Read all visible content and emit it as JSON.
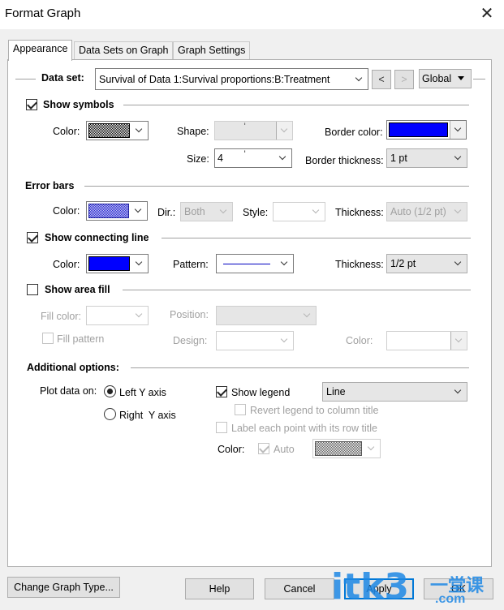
{
  "window": {
    "title": "Format Graph",
    "close_glyph": "✕"
  },
  "tabs": [
    {
      "label": "Appearance"
    },
    {
      "label": "Data Sets on Graph"
    },
    {
      "label": "Graph Settings"
    }
  ],
  "dataset": {
    "label": "Data set:",
    "value": "Survival of Data 1:Survival proportions:B:Treatment",
    "prev_label": "<",
    "next_label": ">",
    "scope_value": "Global"
  },
  "symbols": {
    "title": "Show symbols",
    "checked": true,
    "color_label": "Color:",
    "shape_label": "Shape:",
    "shape_value": "ˈ",
    "border_color_label": "Border color:",
    "size_label": "Size:",
    "size_value": "4",
    "size_marker": "ˈ",
    "border_thickness_label": "Border thickness:",
    "border_thickness_value": "1 pt",
    "border_color": "#0000ff"
  },
  "error_bars": {
    "title": "Error bars",
    "color_label": "Color:",
    "dir_label": "Dir.:",
    "dir_value": "Both",
    "style_label": "Style:",
    "style_value": "",
    "thickness_label": "Thickness:",
    "thickness_value": "Auto (1/2 pt)"
  },
  "connecting_line": {
    "title": "Show connecting line",
    "checked": true,
    "color_label": "Color:",
    "color": "#0000ff",
    "pattern_label": "Pattern:",
    "thickness_label": "Thickness:",
    "thickness_value": "1/2 pt"
  },
  "area_fill": {
    "title": "Show area fill",
    "checked": false,
    "fill_color_label": "Fill color:",
    "position_label": "Position:",
    "fill_pattern_label": "Fill pattern",
    "design_label": "Design:",
    "color_label": "Color:"
  },
  "additional": {
    "title": "Additional options:",
    "plot_on_label": "Plot data on:",
    "left_axis_label": "Left Y axis",
    "right_axis_label": "Right  Y axis",
    "show_legend_label": "Show legend",
    "legend_value": "Line",
    "revert_legend_label": "Revert legend to column title",
    "label_points_label": "Label each point with its row title",
    "color_label": "Color:",
    "auto_label": "Auto"
  },
  "buttons": {
    "change_type": "Change Graph Type...",
    "help": "Help",
    "cancel": "Cancel",
    "apply": "Apply",
    "ok": "OK"
  },
  "watermark": {
    "text": "itk3",
    "sub": "一堂课",
    "domain": ".com"
  }
}
